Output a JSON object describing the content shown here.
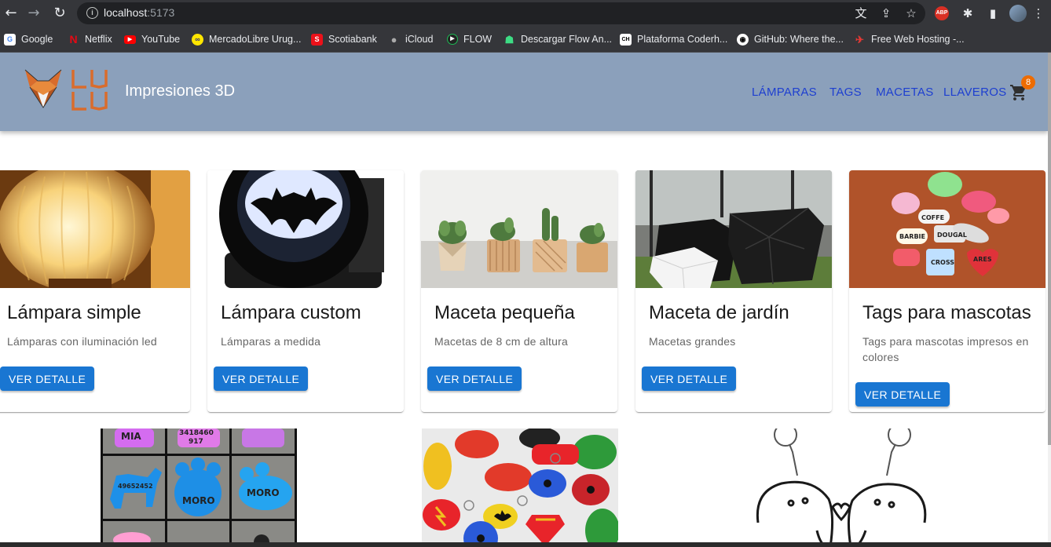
{
  "browser": {
    "url_host": "localhost",
    "url_port": ":5173",
    "bookmarks": [
      {
        "label": "Google",
        "icon": "google-icon",
        "color": "#4285f4"
      },
      {
        "label": "Netflix",
        "icon": "netflix-icon",
        "color": "#e50914"
      },
      {
        "label": "YouTube",
        "icon": "youtube-icon",
        "color": "#ff0000"
      },
      {
        "label": "MercadoLibre Urug...",
        "icon": "mercadolibre-icon",
        "color": "#ffe600"
      },
      {
        "label": "Scotiabank",
        "icon": "scotiabank-icon",
        "color": "#ec111a"
      },
      {
        "label": "iCloud",
        "icon": "apple-icon",
        "color": "#aaaaaa"
      },
      {
        "label": "FLOW",
        "icon": "flow-icon",
        "color": "#1db954"
      },
      {
        "label": "Descargar Flow An...",
        "icon": "android-icon",
        "color": "#3ddc84"
      },
      {
        "label": "Plataforma Coderh...",
        "icon": "coderhouse-icon",
        "color": "#ffffff"
      },
      {
        "label": "GitHub: Where the...",
        "icon": "github-icon",
        "color": "#ffffff"
      },
      {
        "label": "Free Web Hosting -...",
        "icon": "hosting-icon",
        "color": "#e53935"
      }
    ]
  },
  "header": {
    "brand_logo_text": "LULU",
    "brand_title": "Impresiones 3D",
    "nav": [
      "LÁMPARAS",
      "TAGS",
      "MACETAS",
      "LLAVEROS"
    ],
    "cart_count": "8",
    "colors": {
      "background": "#8ba0bb",
      "nav_link": "#1e3fd0",
      "badge": "#ed6c02"
    }
  },
  "products": [
    {
      "title": "Lámpara simple",
      "description": "Lámparas con iluminación led",
      "button": "VER DETALLE",
      "image": "lamp-image"
    },
    {
      "title": "Lámpara custom",
      "description": "Lámparas a medida",
      "button": "VER DETALLE",
      "image": "batman-lamp-image"
    },
    {
      "title": "Maceta pequeña",
      "description": "Macetas de 8 cm de altura",
      "button": "VER DETALLE",
      "image": "small-pots-image"
    },
    {
      "title": "Maceta de jardín",
      "description": "Macetas grandes",
      "button": "VER DETALLE",
      "image": "garden-pots-image"
    },
    {
      "title": "Tags para mascotas",
      "description": "Tags para mascotas impresos en colores",
      "button": "VER DETALLE",
      "image": "pet-tags-image"
    }
  ],
  "second_row_images": [
    {
      "image": "pet-tags-grid-image",
      "text": [
        "MIA",
        "3418460",
        "917",
        "49652452",
        "MORO",
        "MORO"
      ]
    },
    {
      "image": "superhero-keychains-image"
    },
    {
      "image": "couple-keychain-image"
    }
  ],
  "button_color": "#1976d2"
}
